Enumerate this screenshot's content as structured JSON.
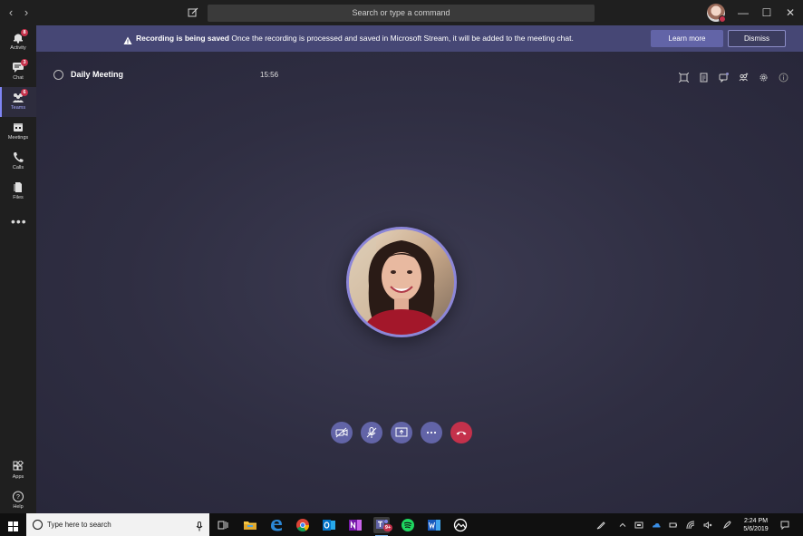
{
  "titlebar": {
    "back": "‹",
    "forward": "›",
    "search_placeholder": "Search or type a command",
    "minimize": "—",
    "maximize": "☐",
    "close": "✕"
  },
  "rail": {
    "items": [
      {
        "label": "Activity",
        "badge": "8"
      },
      {
        "label": "Chat",
        "badge": "3"
      },
      {
        "label": "Teams",
        "badge": "6"
      },
      {
        "label": "Meetings"
      },
      {
        "label": "Calls"
      },
      {
        "label": "Files"
      }
    ],
    "more": "•••",
    "apps": "Apps",
    "help": "Help"
  },
  "banner": {
    "bold": "Recording is being saved",
    "message": " Once the recording is processed and saved in Microsoft Stream, it will be added to the meeting chat.",
    "learn_more": "Learn more",
    "dismiss": "Dismiss"
  },
  "meeting": {
    "title": "Daily Meeting",
    "duration": "15:56"
  },
  "taskbar": {
    "search_placeholder": "Type here to search",
    "teams_badge": "9+",
    "time": "2:24 PM",
    "date": "5/6/2019"
  },
  "colors": {
    "accent": "#6264a7",
    "banner": "#464775",
    "hangup": "#c4314b",
    "badge": "#c4314b"
  }
}
